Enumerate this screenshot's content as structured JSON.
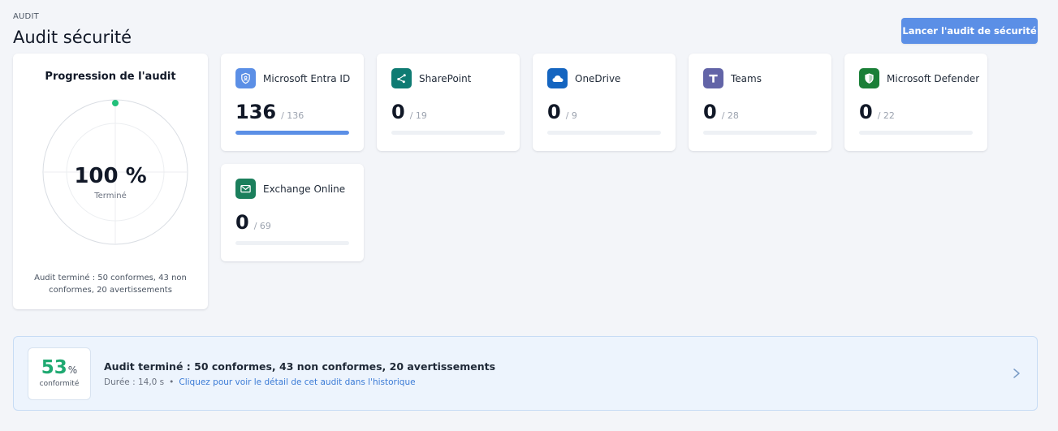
{
  "header": {
    "eyebrow": "AUDIT",
    "title": "Audit sécurité",
    "launch_label": "Lancer l'audit de sécurité"
  },
  "progress": {
    "title": "Progression de l'audit",
    "value_label": "100 %",
    "percent": 100,
    "status": "Terminé",
    "summary": "Audit terminé : 50 conformes, 43 non conformes, 20 avertissements",
    "accent": "#22c07a"
  },
  "services": [
    {
      "name": "Microsoft Entra ID",
      "done": "136",
      "total": "/ 136",
      "fraction": 1.0,
      "icon": "shield-user-icon",
      "color": "#5b8fe6"
    },
    {
      "name": "SharePoint",
      "done": "0",
      "total": "/ 19",
      "fraction": 0,
      "icon": "sharepoint-icon",
      "color": "#0f7b73"
    },
    {
      "name": "OneDrive",
      "done": "0",
      "total": "/ 9",
      "fraction": 0,
      "icon": "cloud-icon",
      "color": "#1565c0"
    },
    {
      "name": "Teams",
      "done": "0",
      "total": "/ 28",
      "fraction": 0,
      "icon": "teams-icon",
      "color": "#6264a7"
    },
    {
      "name": "Microsoft Defender",
      "done": "0",
      "total": "/ 22",
      "fraction": 0,
      "icon": "defender-shield-icon",
      "color": "#1a7f37"
    },
    {
      "name": "Exchange Online",
      "done": "0",
      "total": "/ 69",
      "fraction": 0,
      "icon": "mail-icon",
      "color": "#1b7f5c"
    }
  ],
  "summary": {
    "score": "53",
    "score_unit": "%",
    "score_label": "conformité",
    "title": "Audit terminé : 50 conformes, 43 non conformes, 20 avertissements",
    "duration": "Durée : 14,0 s",
    "separator": "•",
    "link": "Cliquez pour voir le détail de cet audit dans l'historique",
    "score_color": "#1fa971",
    "chevron": "chevron-right-icon"
  }
}
